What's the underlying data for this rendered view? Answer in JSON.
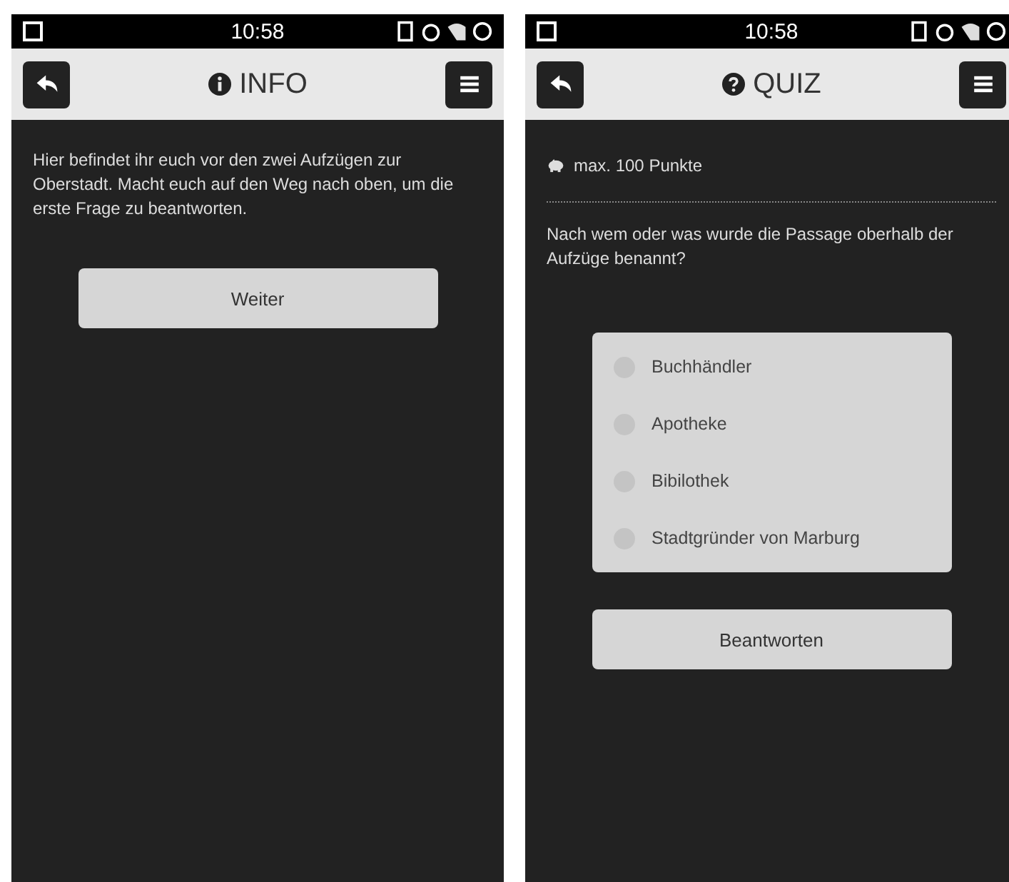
{
  "screens": [
    {
      "kind": "info",
      "status_bar": {
        "time": "10:58"
      },
      "header": {
        "title": "INFO"
      },
      "text": "Hier befindet ihr euch vor den zwei Aufzügen zur Oberstadt. Macht euch auf den Weg nach oben, um die erste Frage zu beantworten.",
      "button": "Weiter"
    },
    {
      "kind": "quiz",
      "status_bar": {
        "time": "10:58"
      },
      "header": {
        "title": "QUIZ"
      },
      "points": "max. 100 Punkte",
      "question": "Nach wem oder was wurde die Passage oberhalb der Aufzüge benannt?",
      "options": [
        {
          "label": "Buchhändler",
          "selected": false
        },
        {
          "label": "Apotheke",
          "selected": false
        },
        {
          "label": "Bibilothek",
          "selected": false
        },
        {
          "label": "Stadtgründer von Marburg",
          "selected": false
        }
      ],
      "button": "Beantworten"
    }
  ]
}
